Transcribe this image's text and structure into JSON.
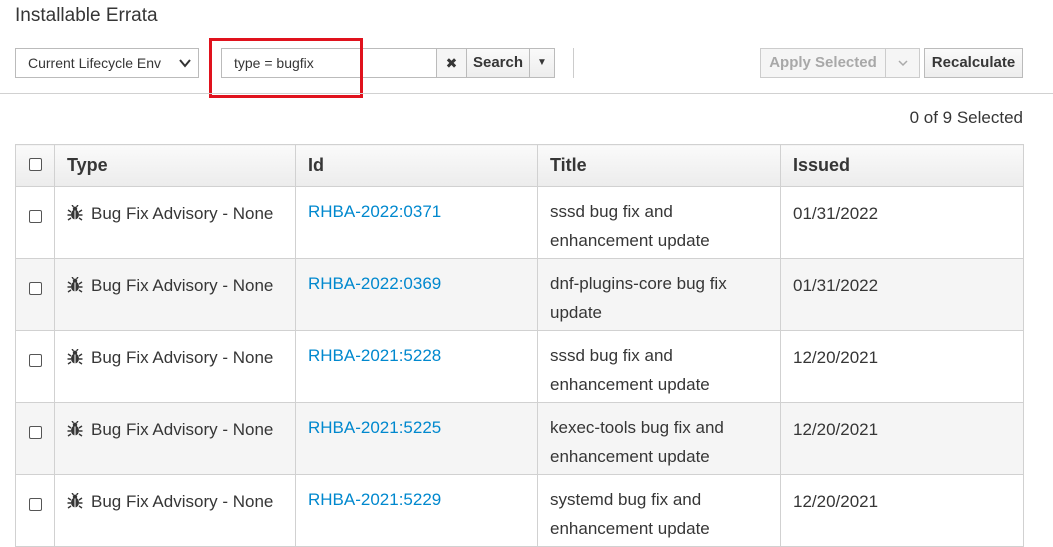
{
  "page": {
    "title": "Installable Errata"
  },
  "toolbar": {
    "env_select_value": "Current Lifecycle Env",
    "search_value": "type =  bugfix",
    "search_button": "Search",
    "apply_selected": "Apply Selected",
    "recalculate": "Recalculate"
  },
  "selection": {
    "count_text": "0 of 9 Selected"
  },
  "table": {
    "headers": {
      "type": "Type",
      "id": "Id",
      "title": "Title",
      "issued": "Issued"
    },
    "rows": [
      {
        "type": "Bug Fix Advisory - None",
        "id": "RHBA-2022:0371",
        "title": "sssd bug fix and enhancement update",
        "issued": "01/31/2022"
      },
      {
        "type": "Bug Fix Advisory - None",
        "id": "RHBA-2022:0369",
        "title": "dnf-plugins-core bug fix update",
        "issued": "01/31/2022"
      },
      {
        "type": "Bug Fix Advisory - None",
        "id": "RHBA-2021:5228",
        "title": "sssd bug fix and enhancement update",
        "issued": "12/20/2021"
      },
      {
        "type": "Bug Fix Advisory - None",
        "id": "RHBA-2021:5225",
        "title": "kexec-tools bug fix and enhancement update",
        "issued": "12/20/2021"
      },
      {
        "type": "Bug Fix Advisory - None",
        "id": "RHBA-2021:5229",
        "title": "systemd bug fix and enhancement update",
        "issued": "12/20/2021"
      }
    ]
  },
  "icons": {
    "row_type_icon": "bug-icon",
    "clear_icon": "close-icon",
    "caret_icon": "caret-down-icon",
    "chevron_icon": "chevron-down-icon"
  },
  "colors": {
    "link": "#0088ce",
    "highlight": "#e0121d"
  }
}
